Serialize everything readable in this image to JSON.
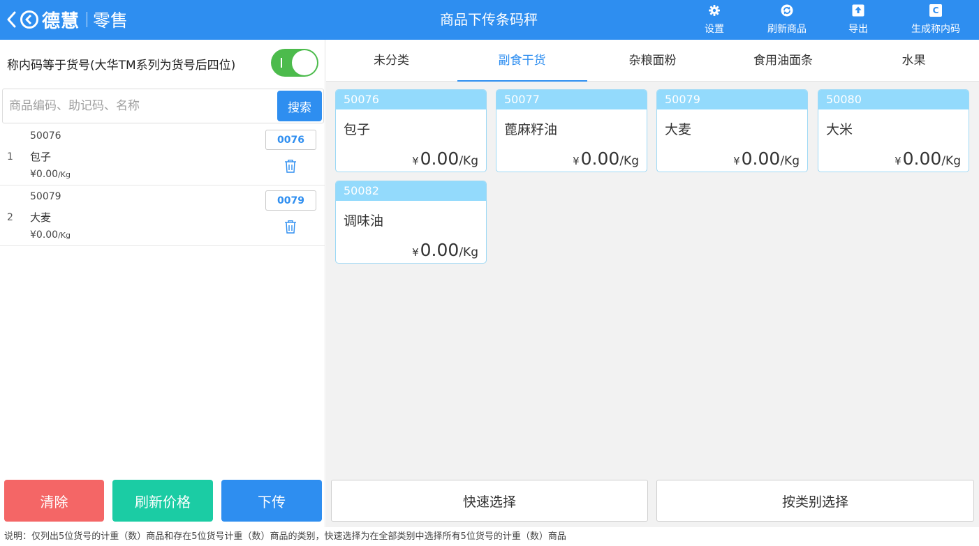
{
  "header": {
    "brand": "德慧",
    "module": "零售",
    "title": "商品下传条码秤",
    "actions": [
      {
        "label": "设置",
        "icon": "gear-icon"
      },
      {
        "label": "刷新商品",
        "icon": "refresh-icon"
      },
      {
        "label": "导出",
        "icon": "export-icon"
      },
      {
        "label": "生成称内码",
        "icon": "generate-code-icon"
      }
    ],
    "generate_icon_letter": "C"
  },
  "left": {
    "toggle_label": "称内码等于货号(大华TM系列为货号后四位)",
    "toggle_on": true,
    "search": {
      "placeholder": "商品编码、助记码、名称",
      "value": "",
      "button": "搜索"
    },
    "selected": [
      {
        "index": "1",
        "code": "50076",
        "name": "包子",
        "price": "¥0.00",
        "unit": "/Kg",
        "plu": "0076"
      },
      {
        "index": "2",
        "code": "50079",
        "name": "大麦",
        "price": "¥0.00",
        "unit": "/Kg",
        "plu": "0079"
      }
    ],
    "buttons": {
      "clear": "清除",
      "refresh_price": "刷新价格",
      "upload": "下传"
    }
  },
  "right": {
    "tabs": [
      "未分类",
      "副食干货",
      "杂粮面粉",
      "食用油面条",
      "水果"
    ],
    "active_tab": 1,
    "products": [
      {
        "code": "50076",
        "name": "包子",
        "currency": "¥",
        "price": "0.00",
        "unit": "/Kg"
      },
      {
        "code": "50077",
        "name": "蓖麻籽油",
        "currency": "¥",
        "price": "0.00",
        "unit": "/Kg"
      },
      {
        "code": "50079",
        "name": "大麦",
        "currency": "¥",
        "price": "0.00",
        "unit": "/Kg"
      },
      {
        "code": "50080",
        "name": "大米",
        "currency": "¥",
        "price": "0.00",
        "unit": "/Kg"
      },
      {
        "code": "50082",
        "name": "调味油",
        "currency": "¥",
        "price": "0.00",
        "unit": "/Kg"
      }
    ],
    "buttons": {
      "quick": "快速选择",
      "by_category": "按类别选择"
    }
  },
  "footer": "说明：仅列出5位货号的计重（数）商品和存在5位货号计重（数）商品的类别，快速选择为在全部类别中选择所有5位货号的计重（数）商品",
  "colors": {
    "primary": "#2e8ef0",
    "clear": "#f46666",
    "refresh_price": "#1bcca4",
    "upload": "#2e8ef0",
    "toggle_on": "#4cbb4c",
    "card_header": "#93dafc"
  }
}
